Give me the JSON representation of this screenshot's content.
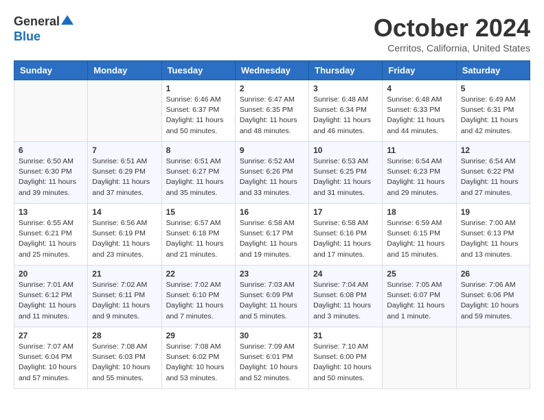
{
  "header": {
    "logo_general": "General",
    "logo_blue": "Blue",
    "month_title": "October 2024",
    "subtitle": "Cerritos, California, United States"
  },
  "weekdays": [
    "Sunday",
    "Monday",
    "Tuesday",
    "Wednesday",
    "Thursday",
    "Friday",
    "Saturday"
  ],
  "weeks": [
    [
      {
        "day": "",
        "info": ""
      },
      {
        "day": "",
        "info": ""
      },
      {
        "day": "1",
        "info": "Sunrise: 6:46 AM\nSunset: 6:37 PM\nDaylight: 11 hours and 50 minutes."
      },
      {
        "day": "2",
        "info": "Sunrise: 6:47 AM\nSunset: 6:35 PM\nDaylight: 11 hours and 48 minutes."
      },
      {
        "day": "3",
        "info": "Sunrise: 6:48 AM\nSunset: 6:34 PM\nDaylight: 11 hours and 46 minutes."
      },
      {
        "day": "4",
        "info": "Sunrise: 6:48 AM\nSunset: 6:33 PM\nDaylight: 11 hours and 44 minutes."
      },
      {
        "day": "5",
        "info": "Sunrise: 6:49 AM\nSunset: 6:31 PM\nDaylight: 11 hours and 42 minutes."
      }
    ],
    [
      {
        "day": "6",
        "info": "Sunrise: 6:50 AM\nSunset: 6:30 PM\nDaylight: 11 hours and 39 minutes."
      },
      {
        "day": "7",
        "info": "Sunrise: 6:51 AM\nSunset: 6:29 PM\nDaylight: 11 hours and 37 minutes."
      },
      {
        "day": "8",
        "info": "Sunrise: 6:51 AM\nSunset: 6:27 PM\nDaylight: 11 hours and 35 minutes."
      },
      {
        "day": "9",
        "info": "Sunrise: 6:52 AM\nSunset: 6:26 PM\nDaylight: 11 hours and 33 minutes."
      },
      {
        "day": "10",
        "info": "Sunrise: 6:53 AM\nSunset: 6:25 PM\nDaylight: 11 hours and 31 minutes."
      },
      {
        "day": "11",
        "info": "Sunrise: 6:54 AM\nSunset: 6:23 PM\nDaylight: 11 hours and 29 minutes."
      },
      {
        "day": "12",
        "info": "Sunrise: 6:54 AM\nSunset: 6:22 PM\nDaylight: 11 hours and 27 minutes."
      }
    ],
    [
      {
        "day": "13",
        "info": "Sunrise: 6:55 AM\nSunset: 6:21 PM\nDaylight: 11 hours and 25 minutes."
      },
      {
        "day": "14",
        "info": "Sunrise: 6:56 AM\nSunset: 6:19 PM\nDaylight: 11 hours and 23 minutes."
      },
      {
        "day": "15",
        "info": "Sunrise: 6:57 AM\nSunset: 6:18 PM\nDaylight: 11 hours and 21 minutes."
      },
      {
        "day": "16",
        "info": "Sunrise: 6:58 AM\nSunset: 6:17 PM\nDaylight: 11 hours and 19 minutes."
      },
      {
        "day": "17",
        "info": "Sunrise: 6:58 AM\nSunset: 6:16 PM\nDaylight: 11 hours and 17 minutes."
      },
      {
        "day": "18",
        "info": "Sunrise: 6:59 AM\nSunset: 6:15 PM\nDaylight: 11 hours and 15 minutes."
      },
      {
        "day": "19",
        "info": "Sunrise: 7:00 AM\nSunset: 6:13 PM\nDaylight: 11 hours and 13 minutes."
      }
    ],
    [
      {
        "day": "20",
        "info": "Sunrise: 7:01 AM\nSunset: 6:12 PM\nDaylight: 11 hours and 11 minutes."
      },
      {
        "day": "21",
        "info": "Sunrise: 7:02 AM\nSunset: 6:11 PM\nDaylight: 11 hours and 9 minutes."
      },
      {
        "day": "22",
        "info": "Sunrise: 7:02 AM\nSunset: 6:10 PM\nDaylight: 11 hours and 7 minutes."
      },
      {
        "day": "23",
        "info": "Sunrise: 7:03 AM\nSunset: 6:09 PM\nDaylight: 11 hours and 5 minutes."
      },
      {
        "day": "24",
        "info": "Sunrise: 7:04 AM\nSunset: 6:08 PM\nDaylight: 11 hours and 3 minutes."
      },
      {
        "day": "25",
        "info": "Sunrise: 7:05 AM\nSunset: 6:07 PM\nDaylight: 11 hours and 1 minute."
      },
      {
        "day": "26",
        "info": "Sunrise: 7:06 AM\nSunset: 6:06 PM\nDaylight: 10 hours and 59 minutes."
      }
    ],
    [
      {
        "day": "27",
        "info": "Sunrise: 7:07 AM\nSunset: 6:04 PM\nDaylight: 10 hours and 57 minutes."
      },
      {
        "day": "28",
        "info": "Sunrise: 7:08 AM\nSunset: 6:03 PM\nDaylight: 10 hours and 55 minutes."
      },
      {
        "day": "29",
        "info": "Sunrise: 7:08 AM\nSunset: 6:02 PM\nDaylight: 10 hours and 53 minutes."
      },
      {
        "day": "30",
        "info": "Sunrise: 7:09 AM\nSunset: 6:01 PM\nDaylight: 10 hours and 52 minutes."
      },
      {
        "day": "31",
        "info": "Sunrise: 7:10 AM\nSunset: 6:00 PM\nDaylight: 10 hours and 50 minutes."
      },
      {
        "day": "",
        "info": ""
      },
      {
        "day": "",
        "info": ""
      }
    ]
  ]
}
